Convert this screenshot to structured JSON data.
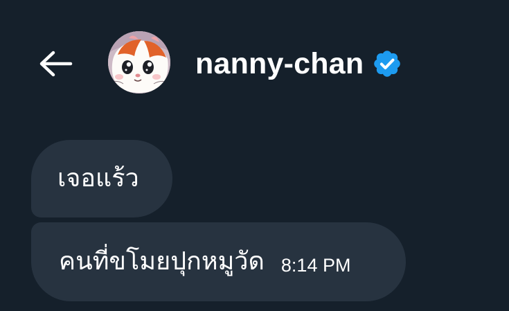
{
  "header": {
    "back_icon": "arrow-left-icon",
    "avatar_alt": "hamster avatar",
    "display_name": "nanny-chan",
    "verified_icon": "verified-badge-icon",
    "verified_color": "#1d9bf0"
  },
  "messages": [
    {
      "text": "เจอแร้ว"
    },
    {
      "text": "คนที่ขโมยปุกหมูวัด",
      "time": "8:14 PM"
    }
  ],
  "colors": {
    "background": "#15202b",
    "bubble": "#273340",
    "text": "#ffffff"
  }
}
